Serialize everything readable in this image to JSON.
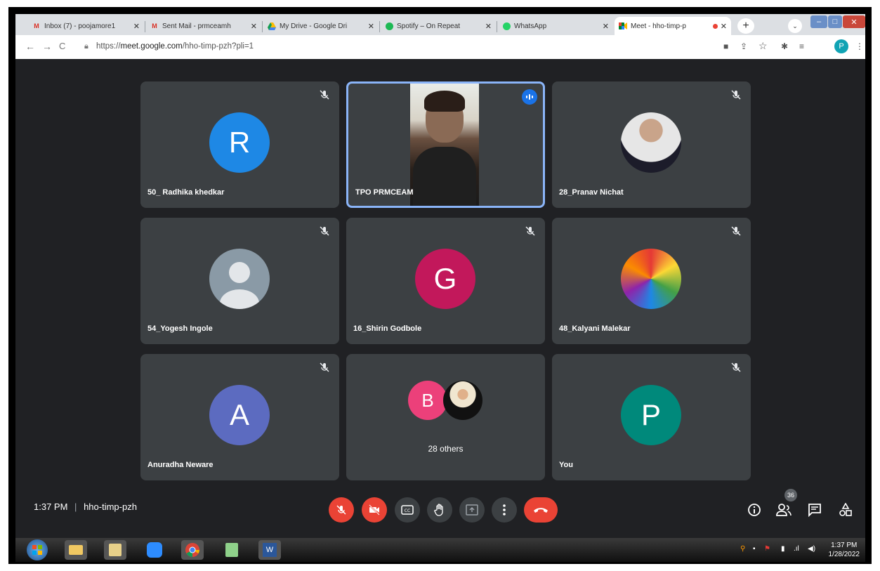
{
  "browser": {
    "tabs": [
      {
        "title": "Inbox (7) - poojamore1",
        "icon": "gmail-icon"
      },
      {
        "title": "Sent Mail - prmceamh",
        "icon": "gmail-icon"
      },
      {
        "title": "My Drive - Google Dri",
        "icon": "drive-icon"
      },
      {
        "title": "Spotify – On Repeat",
        "icon": "spotify-icon"
      },
      {
        "title": "WhatsApp",
        "icon": "whatsapp-icon"
      },
      {
        "title": "Meet - hho-timp-p",
        "icon": "meet-icon",
        "active": true
      }
    ],
    "url_prefix": "https://",
    "url_domain": "meet.google.com",
    "url_path": "/hho-timp-pzh?pli=1",
    "profile_initial": "P"
  },
  "participants": [
    {
      "name": "50_ Radhika khedkar",
      "initial": "R",
      "color": "#1e88e5"
    },
    {
      "name": "TPO PRMCEAM",
      "speaking": true
    },
    {
      "name": "28_Pranav Nichat"
    },
    {
      "name": "54_Yogesh Ingole"
    },
    {
      "name": "16_Shirin Godbole",
      "initial": "G",
      "color": "#c2185b"
    },
    {
      "name": "48_Kalyani Malekar"
    },
    {
      "name": "Anuradha Neware",
      "initial": "A",
      "color": "#5c6bc0"
    },
    {
      "name": "28 others",
      "initial": "B",
      "color": "#ec407a"
    },
    {
      "name": "You",
      "initial": "P",
      "color": "#00897b"
    }
  ],
  "meeting": {
    "time": "1:37 PM",
    "code": "hho-timp-pzh",
    "participant_count": "36"
  },
  "taskbar": {
    "time": "1:37 PM",
    "date": "1/28/2022"
  }
}
